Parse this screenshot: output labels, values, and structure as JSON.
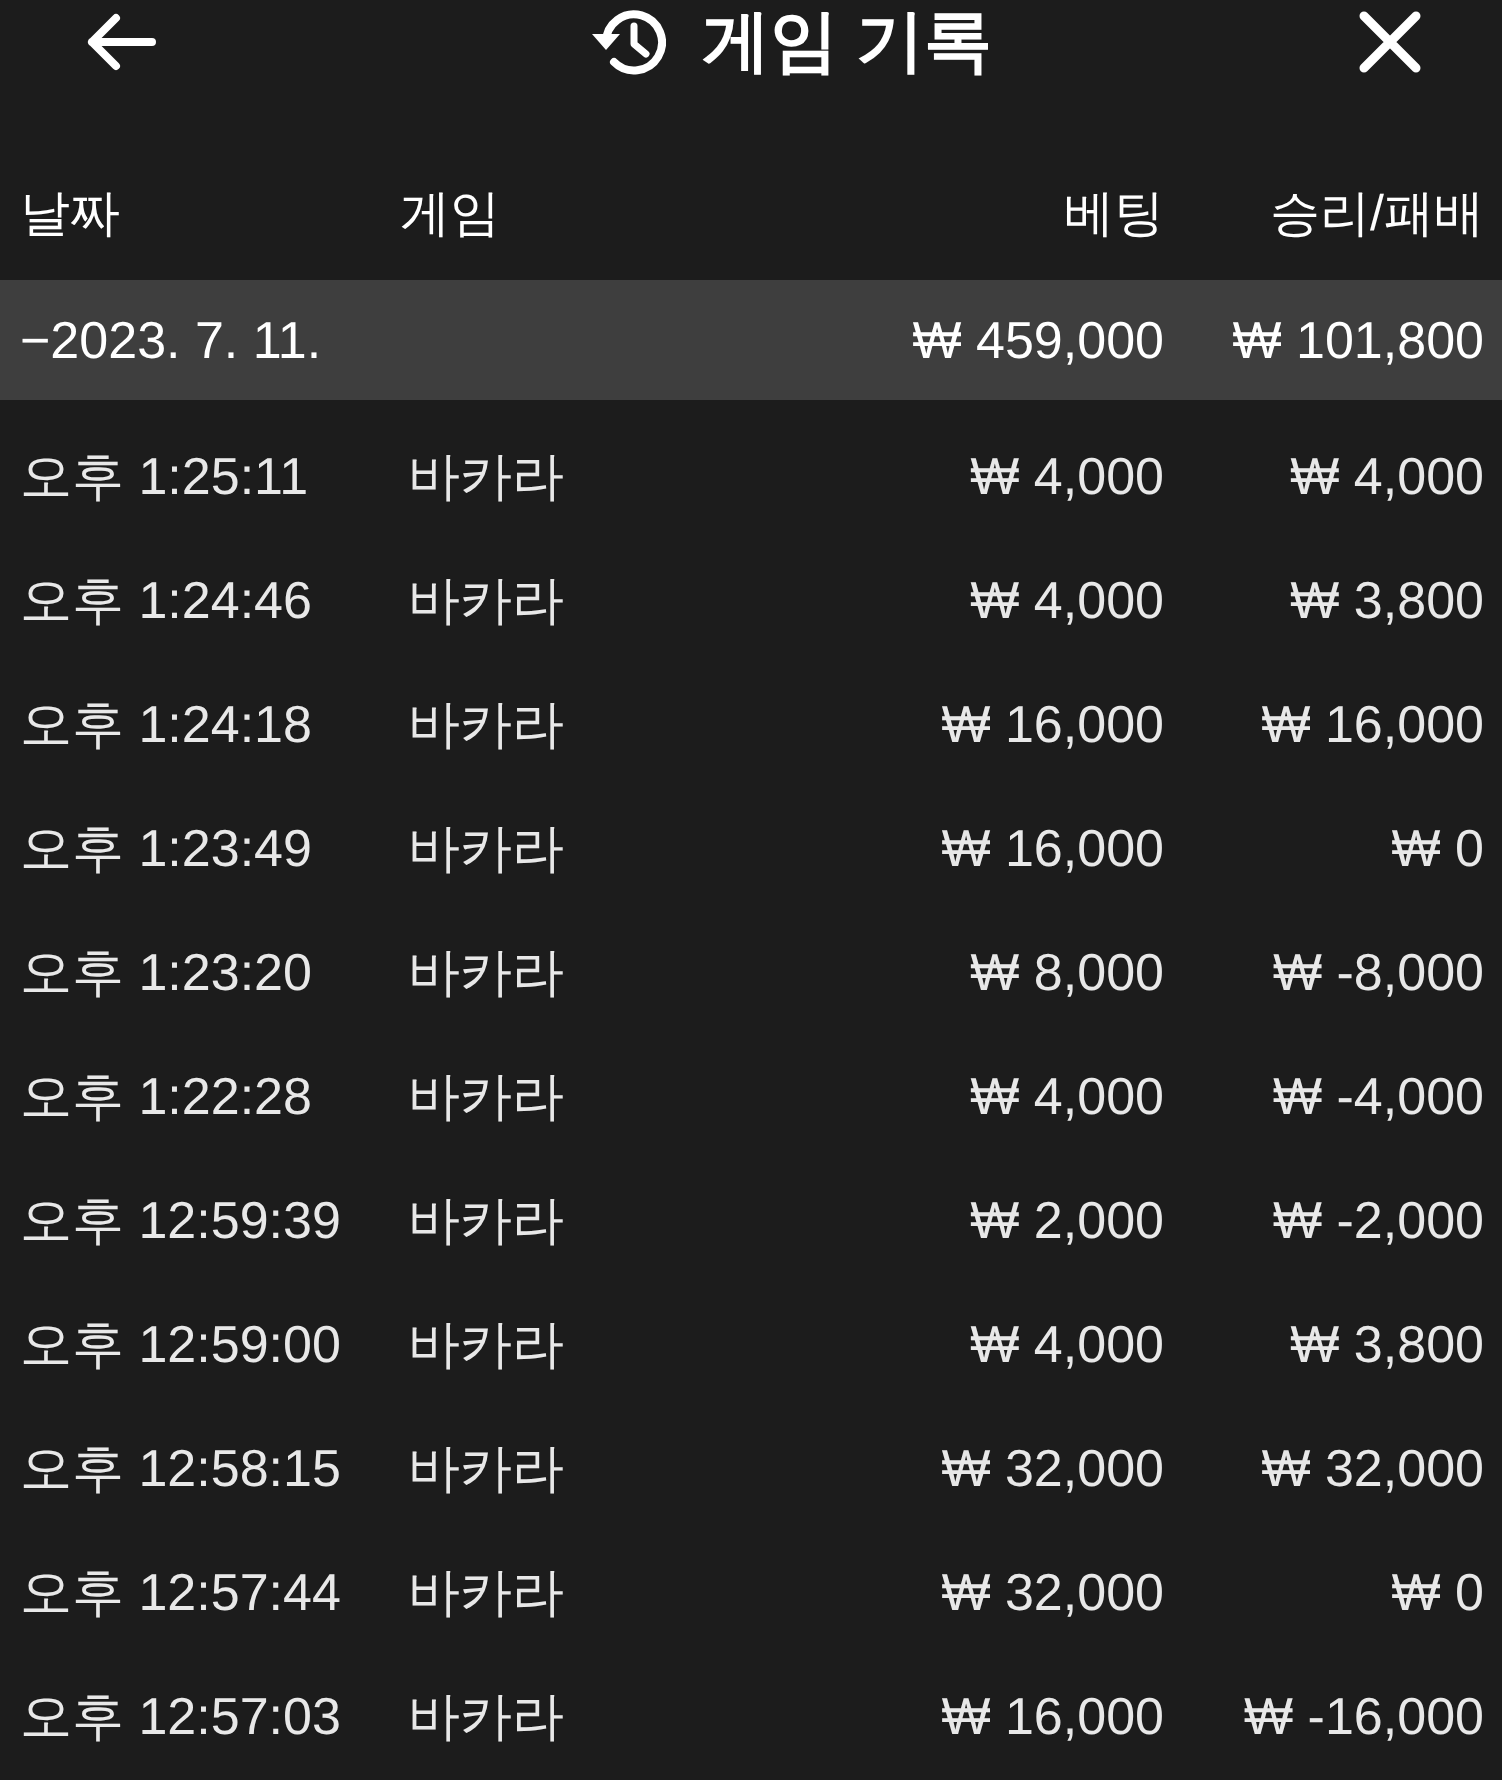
{
  "header": {
    "title": "게임 기록"
  },
  "columns": [
    "날짜",
    "게임",
    "베팅",
    "승리/패배"
  ],
  "groups": [
    {
      "date": "−2023. 7. 11.",
      "total_bet": "₩ 459,000",
      "total_result": "₩ 101,800",
      "rows": [
        {
          "time": "오후 1:25:11",
          "game": "바카라",
          "bet": "₩ 4,000",
          "result": "₩ 4,000"
        },
        {
          "time": "오후 1:24:46",
          "game": "바카라",
          "bet": "₩ 4,000",
          "result": "₩ 3,800"
        },
        {
          "time": "오후 1:24:18",
          "game": "바카라",
          "bet": "₩ 16,000",
          "result": "₩ 16,000"
        },
        {
          "time": "오후 1:23:49",
          "game": "바카라",
          "bet": "₩ 16,000",
          "result": "₩ 0"
        },
        {
          "time": "오후 1:23:20",
          "game": "바카라",
          "bet": "₩ 8,000",
          "result": "₩ -8,000"
        },
        {
          "time": "오후 1:22:28",
          "game": "바카라",
          "bet": "₩ 4,000",
          "result": "₩ -4,000"
        },
        {
          "time": "오후 12:59:39",
          "game": "바카라",
          "bet": "₩ 2,000",
          "result": "₩ -2,000"
        },
        {
          "time": "오후 12:59:00",
          "game": "바카라",
          "bet": "₩ 4,000",
          "result": "₩ 3,800"
        },
        {
          "time": "오후 12:58:15",
          "game": "바카라",
          "bet": "₩ 32,000",
          "result": "₩ 32,000"
        },
        {
          "time": "오후 12:57:44",
          "game": "바카라",
          "bet": "₩ 32,000",
          "result": "₩ 0"
        },
        {
          "time": "오후 12:57:03",
          "game": "바카라",
          "bet": "₩ 16,000",
          "result": "₩ -16,000"
        }
      ]
    }
  ]
}
